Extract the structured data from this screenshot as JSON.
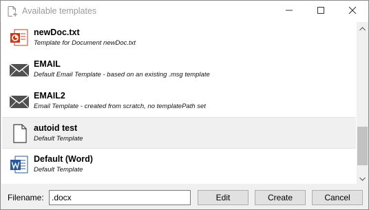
{
  "window": {
    "title": "Available templates",
    "title_icon": "add-document-icon",
    "controls": [
      "minimize-icon",
      "maximize-icon",
      "close-icon"
    ]
  },
  "templates": [
    {
      "name": "newDoc.txt",
      "description": "Template for Document newDoc.txt",
      "icon": "presentation-doc-icon",
      "selected": false
    },
    {
      "name": "EMAIL",
      "description": "Default Email Template - based on an existing .msg template",
      "icon": "envelope-icon",
      "selected": false
    },
    {
      "name": "EMAIL2",
      "description": "Email Template - created from scratch, no templatePath set",
      "icon": "envelope-icon",
      "selected": false
    },
    {
      "name": "autoid test",
      "description": "Default Template",
      "icon": "blank-document-icon",
      "selected": true
    },
    {
      "name": "Default (Word)",
      "description": "Default Template",
      "icon": "word-document-icon",
      "selected": false
    }
  ],
  "footer": {
    "filename_label": "Filename:",
    "filename_value": ".docx",
    "edit_label": "Edit",
    "create_label": "Create",
    "cancel_label": "Cancel"
  },
  "colors": {
    "selected_row": "#f0f0f0",
    "envelope": "#505050",
    "word_blue": "#2b579a",
    "presentation_red": "#c43e1c"
  }
}
